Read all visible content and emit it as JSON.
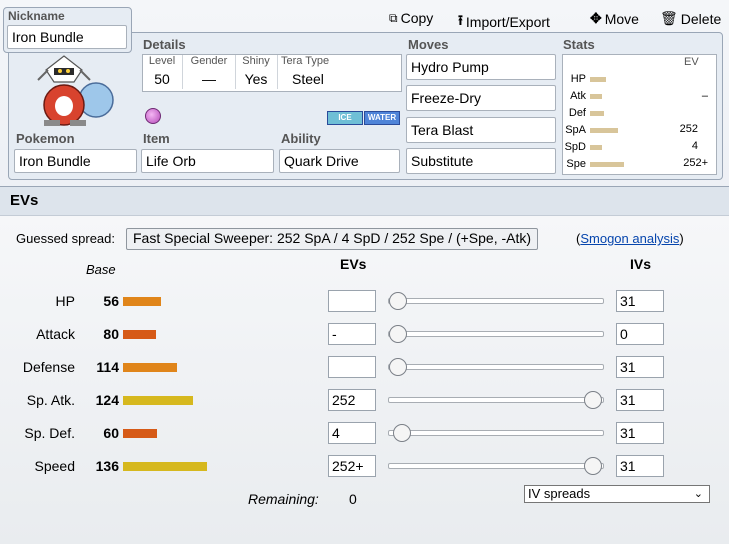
{
  "toolbar": {
    "copy": "Copy",
    "import_export": "Import/Export",
    "move": "Move",
    "delete": "Delete"
  },
  "nickname": {
    "label": "Nickname",
    "value": "Iron Bundle"
  },
  "details": {
    "label": "Details",
    "level_label": "Level",
    "level": "50",
    "gender_label": "Gender",
    "gender": "—",
    "shiny_label": "Shiny",
    "shiny": "Yes",
    "tera_label": "Tera Type",
    "tera": "Steel"
  },
  "types": [
    "ICE",
    "WATER"
  ],
  "pokemon": {
    "label": "Pokemon",
    "value": "Iron Bundle"
  },
  "item": {
    "label": "Item",
    "value": "Life Orb"
  },
  "ability": {
    "label": "Ability",
    "value": "Quark Drive"
  },
  "moves": {
    "label": "Moves",
    "list": [
      "Hydro Pump",
      "Freeze-Dry",
      "Tera Blast",
      "Substitute"
    ]
  },
  "stats_panel": {
    "label": "Stats",
    "ev_label": "EV",
    "rows": [
      {
        "name": "HP",
        "ev": ""
      },
      {
        "name": "Atk",
        "ev": "–"
      },
      {
        "name": "Def",
        "ev": ""
      },
      {
        "name": "SpA",
        "ev": "252"
      },
      {
        "name": "SpD",
        "ev": "4"
      },
      {
        "name": "Spe",
        "ev": "252+"
      }
    ]
  },
  "evs": {
    "title": "EVs",
    "guessed_label": "Guessed spread:",
    "guessed_value": "Fast Special Sweeper: 252 SpA / 4 SpD / 252 Spe / (+Spe, -Atk)",
    "smogon_link": "Smogon analysis",
    "paren_open": "(",
    "paren_close": ")",
    "base_header": "Base",
    "evs_header": "EVs",
    "ivs_header": "IVs",
    "remaining_label": "Remaining:",
    "remaining_value": "0",
    "iv_spreads": "IV spreads",
    "rows": [
      {
        "name": "HP",
        "base": "56",
        "ev": "",
        "iv": "31",
        "slider": 0
      },
      {
        "name": "Attack",
        "base": "80",
        "ev": "-",
        "iv": "0",
        "slider": 0
      },
      {
        "name": "Defense",
        "base": "114",
        "ev": "",
        "iv": "31",
        "slider": 0
      },
      {
        "name": "Sp. Atk.",
        "base": "124",
        "ev": "252",
        "iv": "31",
        "slider": 252
      },
      {
        "name": "Sp. Def.",
        "base": "60",
        "ev": "4",
        "iv": "31",
        "slider": 4
      },
      {
        "name": "Speed",
        "base": "136",
        "ev": "252+",
        "iv": "31",
        "slider": 252
      }
    ]
  },
  "colors": {
    "orange": "#e0851a",
    "red_orange": "#d65a17",
    "gold": "#d6b81e",
    "link": "#0645ad"
  }
}
